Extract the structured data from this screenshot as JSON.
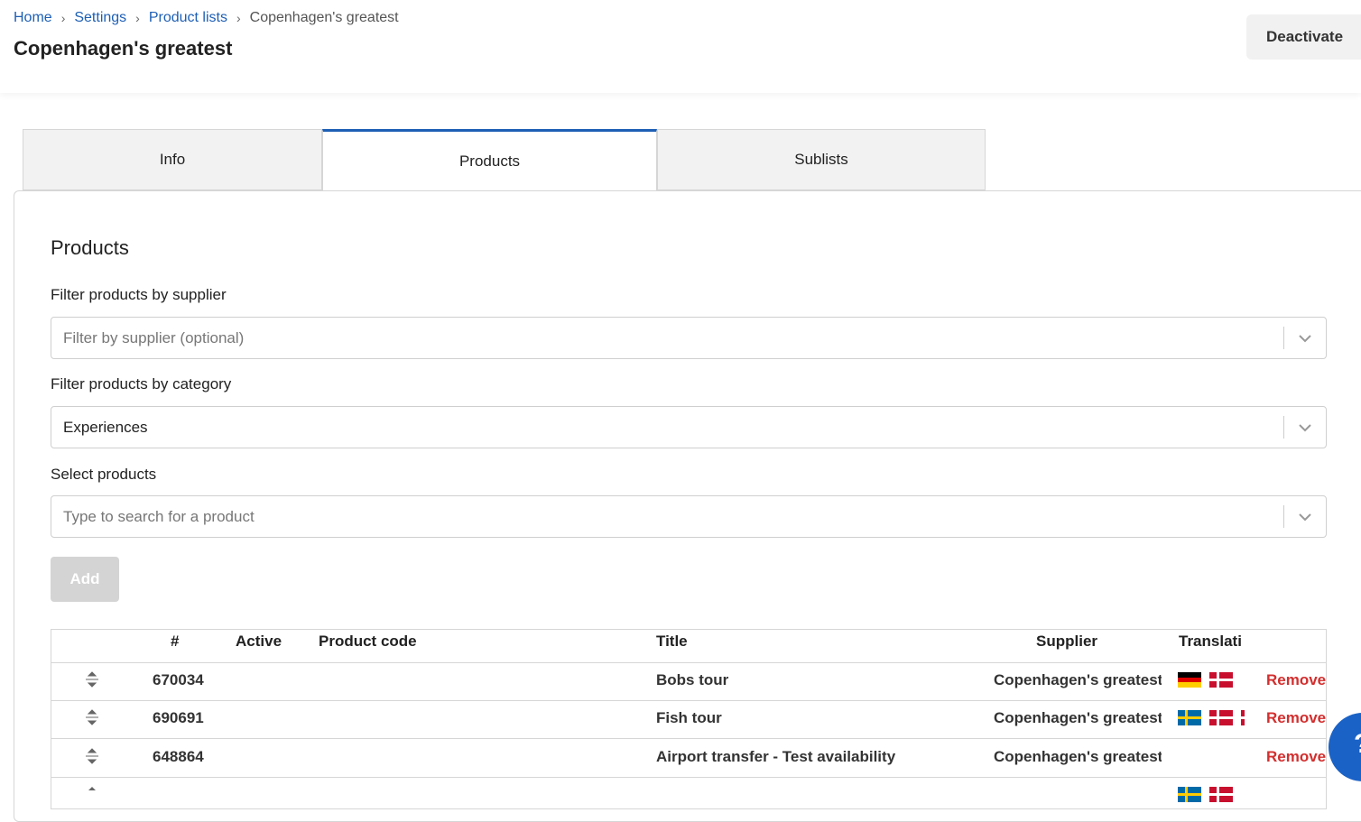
{
  "breadcrumb": [
    "Home",
    "Settings",
    "Product lists",
    "Copenhagen's greatest"
  ],
  "page_title": "Copenhagen's greatest",
  "deactivate_label": "Deactivate",
  "tabs": [
    "Info",
    "Products",
    "Sublists"
  ],
  "active_tab": "Products",
  "products": {
    "title": "Products",
    "supplier_filter": {
      "label": "Filter products by supplier",
      "placeholder": "Filter by supplier (optional)"
    },
    "category_filter": {
      "label": "Filter products by category",
      "value": "Experiences"
    },
    "product_select": {
      "label": "Select products",
      "placeholder": "Type to search for a product"
    },
    "add_label": "Add"
  },
  "table": {
    "columns": [
      "#",
      "Active",
      "Product code",
      "Title",
      "Supplier",
      "Translati"
    ],
    "remove_label": "Remove",
    "rows": [
      {
        "id": "670034",
        "title": "Bobs tour",
        "supplier": "Copenhagen's greatest",
        "flags": [
          "de",
          "dk"
        ]
      },
      {
        "id": "690691",
        "title": "Fish tour",
        "supplier": "Copenhagen's greatest",
        "flags": [
          "se",
          "dk",
          "dk"
        ]
      },
      {
        "id": "648864",
        "title": "Airport transfer - Test availability",
        "supplier": "Copenhagen's greatest",
        "flags": []
      }
    ]
  },
  "colors": {
    "link": "#1d5fb5",
    "remove": "#d32f2f",
    "help_button": "#1a62c6"
  },
  "help_button_label": "?"
}
